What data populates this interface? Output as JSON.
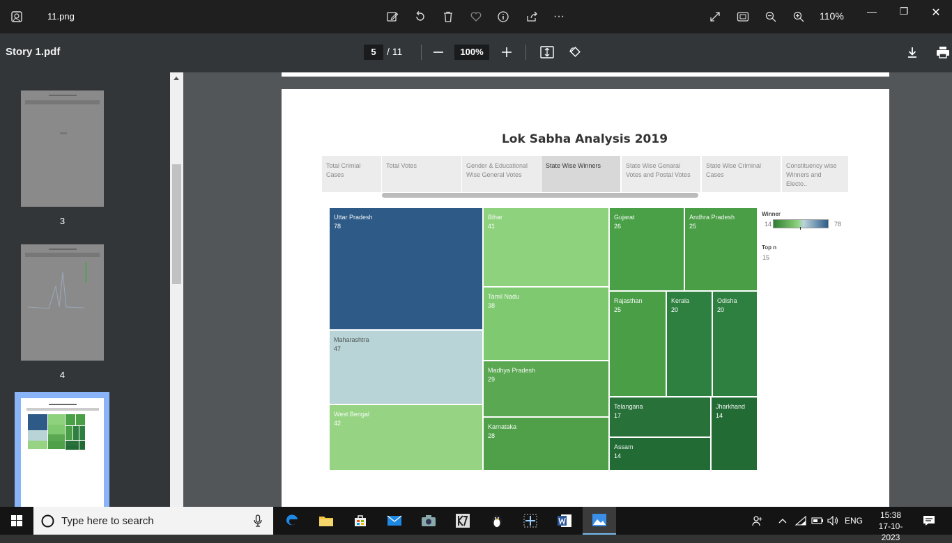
{
  "app": {
    "file_name": "11.png",
    "zoom": "110%"
  },
  "pdf": {
    "title": "Story 1.pdf",
    "current_page": "5",
    "page_total": "/ 11",
    "zoom": "100%"
  },
  "sidebar": {
    "thumbnails": [
      {
        "label": "3"
      },
      {
        "label": "4"
      },
      {
        "label": ""
      }
    ]
  },
  "report": {
    "title": "Lok Sabha Analysis 2019",
    "tabs": [
      {
        "label": "Total Crimial Cases"
      },
      {
        "label": "Total Votes"
      },
      {
        "label": "Gender & Educational Wise General Votes"
      },
      {
        "label": "State Wise Winners"
      },
      {
        "label": "State Wise Genaral Votes and Postal Votes"
      },
      {
        "label": "State Wise Criminal Cases"
      },
      {
        "label": "Constituency wise Winners and Electo.."
      }
    ],
    "legend": {
      "title": "Winner",
      "min": "14",
      "max": "78"
    },
    "topn": {
      "title": "Top n",
      "value": "15"
    }
  },
  "chart_data": {
    "type": "treemap",
    "title": "Lok Sabha Analysis 2019",
    "items": [
      {
        "name": "Uttar Pradesh",
        "value": 78,
        "color": "#2d5a87"
      },
      {
        "name": "Maharashtra",
        "value": 47,
        "color": "#b8d4d6"
      },
      {
        "name": "West Bengal",
        "value": 42,
        "color": "#96d483"
      },
      {
        "name": "Bihar",
        "value": 41,
        "color": "#8fd27e"
      },
      {
        "name": "Tamil Nadu",
        "value": 38,
        "color": "#7fc970"
      },
      {
        "name": "Madhya Pradesh",
        "value": 29,
        "color": "#5aa852"
      },
      {
        "name": "Karnataka",
        "value": 28,
        "color": "#4fa049"
      },
      {
        "name": "Gujarat",
        "value": 26,
        "color": "#49a046"
      },
      {
        "name": "Andhra Pradesh",
        "value": 25,
        "color": "#4a9e46"
      },
      {
        "name": "Rajasthan",
        "value": 25,
        "color": "#4a9e46"
      },
      {
        "name": "Kerala",
        "value": 20,
        "color": "#2e8040"
      },
      {
        "name": "Odisha",
        "value": 20,
        "color": "#2e8040"
      },
      {
        "name": "Telangana",
        "value": 17,
        "color": "#287138"
      },
      {
        "name": "Jharkhand",
        "value": 14,
        "color": "#226b35"
      },
      {
        "name": "Assam",
        "value": 14,
        "color": "#226b35"
      }
    ]
  },
  "taskbar": {
    "search_placeholder": "Type here to search",
    "language": "ENG",
    "time": "15:38",
    "date": "17-10-2023"
  }
}
